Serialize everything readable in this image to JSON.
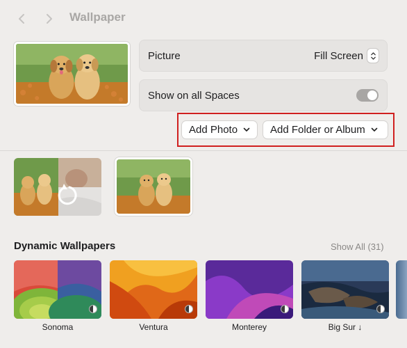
{
  "header": {
    "title": "Wallpaper",
    "back_icon": "chevron-left-icon",
    "forward_icon": "chevron-right-icon"
  },
  "settings": {
    "picture_label": "Picture",
    "picture_value": "Fill Screen",
    "spaces_label": "Show on all Spaces",
    "spaces_toggle": "on"
  },
  "actions": {
    "add_photo": "Add Photo",
    "add_folder": "Add Folder or Album",
    "highlight_color": "#d01f1f"
  },
  "dynamic": {
    "title": "Dynamic Wallpapers",
    "show_all": "Show All (31)",
    "items": [
      {
        "label": "Sonoma"
      },
      {
        "label": "Ventura"
      },
      {
        "label": "Monterey"
      },
      {
        "label": "Big Sur ↓"
      }
    ]
  }
}
